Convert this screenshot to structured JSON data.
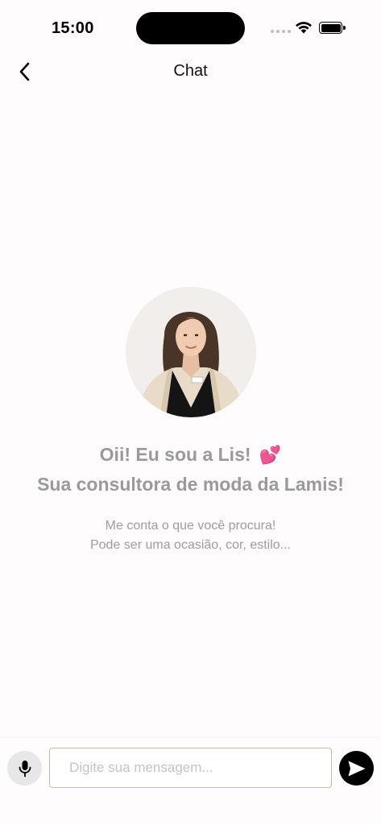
{
  "status_bar": {
    "time": "15:00"
  },
  "nav": {
    "title": "Chat",
    "back_icon": "chevron-left-icon"
  },
  "welcome": {
    "greeting_line1": "Oii! Eu sou a Lis!",
    "greeting_emoji": "💕",
    "greeting_line2": "Sua consultora de moda da Lamis!",
    "subtitle_line1": "Me conta o que você procura!",
    "subtitle_line2": "Pode ser uma ocasião, cor, estilo...",
    "avatar_icon": "assistant-avatar"
  },
  "input_bar": {
    "placeholder": "Digite sua mensagem...",
    "value": "",
    "mic_icon": "microphone-icon",
    "send_icon": "send-icon"
  },
  "colors": {
    "background": "#fefcfc",
    "greeting_text": "#9a9a9a",
    "input_border": "#c9b8ab",
    "send_button": "#000000",
    "mic_button": "#e7e7e7"
  }
}
